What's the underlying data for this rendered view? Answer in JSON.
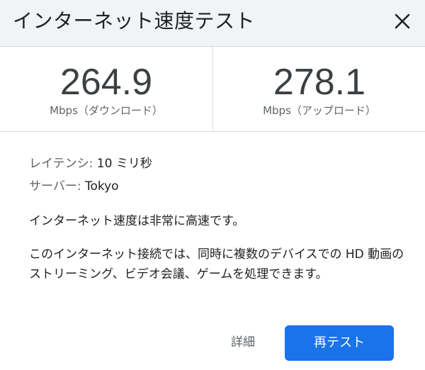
{
  "header": {
    "title": "インターネット速度テスト",
    "close_icon": "close-icon"
  },
  "speeds": {
    "download": {
      "value": "264.9",
      "unit": "Mbps（ダウンロード）"
    },
    "upload": {
      "value": "278.1",
      "unit": "Mbps（アップロード）"
    }
  },
  "info": {
    "latency_label": "レイテンシ:",
    "latency_value": "10 ミリ秒",
    "server_label": "サーバー:",
    "server_value": "Tokyo"
  },
  "summary": "インターネット速度は非常に高速です。",
  "description": "このインターネット接続では、同時に複数のデバイスでの HD 動画のストリーミング、ビデオ会議、ゲームを処理できます。",
  "actions": {
    "details_label": "詳細",
    "retest_label": "再テスト"
  },
  "colors": {
    "accent": "#1a73e8",
    "header_bg": "#f1f3f4",
    "divider": "#dadce0"
  }
}
